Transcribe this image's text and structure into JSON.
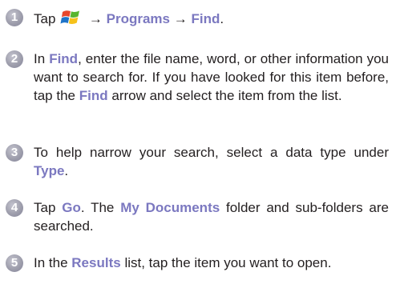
{
  "accent_color": "#7b78c0",
  "steps": [
    {
      "number": "1",
      "tap": "Tap",
      "icon": "windows-start-icon",
      "arrow1": "→",
      "programs": "Programs",
      "arrow2": "→",
      "find": "Find",
      "end": "."
    },
    {
      "number": "2",
      "in": "In",
      "find": "Find",
      "mid": ", enter the file name, word, or other information you want to search for. If you have looked for this item before, tap the",
      "find2": "Find",
      "end": "arrow and select the item from the list."
    },
    {
      "number": "3",
      "text": "To help narrow your search, select a data type under",
      "type": "Type",
      "end": "."
    },
    {
      "number": "4",
      "tap": "Tap",
      "go": "Go",
      "mid": ". The",
      "my_documents": "My Documents",
      "end": "folder and sub-folders are searched."
    },
    {
      "number": "5",
      "in_the": "In the",
      "results": "Results",
      "end": "list, tap the item you want to open."
    }
  ]
}
